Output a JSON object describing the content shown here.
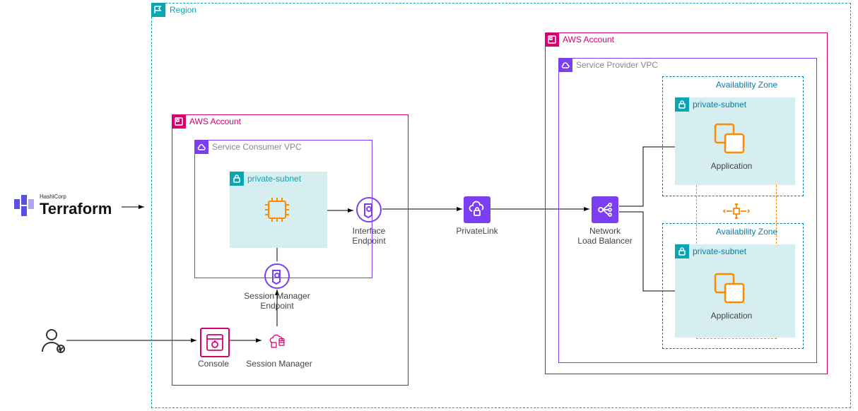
{
  "terraform": {
    "brand_top": "HashiCorp",
    "brand": "Terraform"
  },
  "region": {
    "label": "Region"
  },
  "consumer_account": {
    "label": "AWS Account"
  },
  "consumer_vpc": {
    "label": "Service Consumer VPC"
  },
  "consumer_subnet": {
    "label": "private-subnet"
  },
  "interface_endpoint": {
    "label": "Interface\nEndpoint"
  },
  "session_manager_endpoint": {
    "label": "Session Manager\nEndpoint"
  },
  "console": {
    "label": "Console"
  },
  "session_manager": {
    "label": "Session Manager"
  },
  "privatelink": {
    "label": "PrivateLink"
  },
  "nlb": {
    "label": "Network\nLoad Balancer"
  },
  "provider_account": {
    "label": "AWS Account"
  },
  "provider_vpc": {
    "label": "Service Provider VPC"
  },
  "az_top": {
    "label": "Availability Zone"
  },
  "az_bottom": {
    "label": "Availability Zone"
  },
  "subnet_top": {
    "label": "private-subnet"
  },
  "subnet_bottom": {
    "label": "private-subnet"
  },
  "app_top": {
    "label": "Application"
  },
  "app_bottom": {
    "label": "Application"
  }
}
